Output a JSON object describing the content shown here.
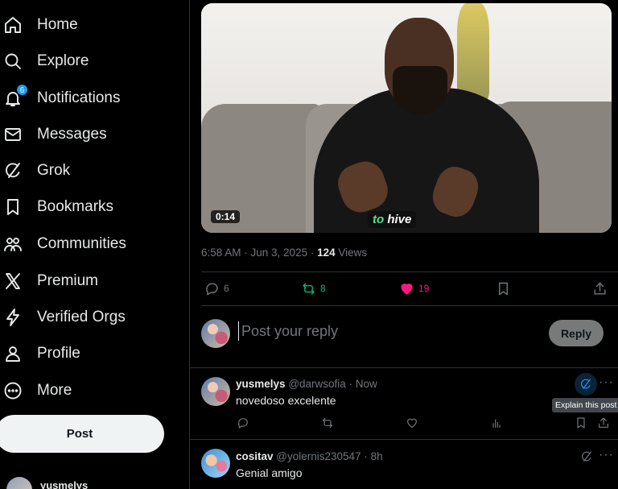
{
  "sidebar": {
    "items": [
      {
        "label": "Home",
        "icon": "home-icon"
      },
      {
        "label": "Explore",
        "icon": "search-icon"
      },
      {
        "label": "Notifications",
        "icon": "bell-icon",
        "badge": "6"
      },
      {
        "label": "Messages",
        "icon": "envelope-icon"
      },
      {
        "label": "Grok",
        "icon": "grok-icon"
      },
      {
        "label": "Bookmarks",
        "icon": "bookmark-icon"
      },
      {
        "label": "Communities",
        "icon": "communities-icon"
      },
      {
        "label": "Premium",
        "icon": "x-logo-icon"
      },
      {
        "label": "Verified Orgs",
        "icon": "lightning-icon"
      },
      {
        "label": "Profile",
        "icon": "person-icon"
      },
      {
        "label": "More",
        "icon": "more-circle-icon"
      }
    ],
    "post_label": "Post",
    "account_name": "yusmelys"
  },
  "video": {
    "duration": "0:14",
    "caption_em": "to",
    "caption_rest": " hive"
  },
  "post_meta": {
    "time": "6:58 AM · Jun 3, 2025 · ",
    "views_count": "124",
    "views_label": " Views"
  },
  "actions": {
    "replies": "6",
    "reposts": "8",
    "likes": "19"
  },
  "reply_box": {
    "placeholder": "Post your reply",
    "button": "Reply"
  },
  "replies": [
    {
      "name": "yusmelys",
      "handle": "@darwsofia · Now",
      "text": "novedoso excelente",
      "tooltip": "Explain this post"
    },
    {
      "name": "cositav",
      "handle": "@yolernis230547 · 8h",
      "text": "Genial amigo"
    }
  ],
  "colors": {
    "accent": "#1d9bf0",
    "like": "#f91880",
    "repost": "#00ba7c",
    "muted": "#71767b"
  }
}
